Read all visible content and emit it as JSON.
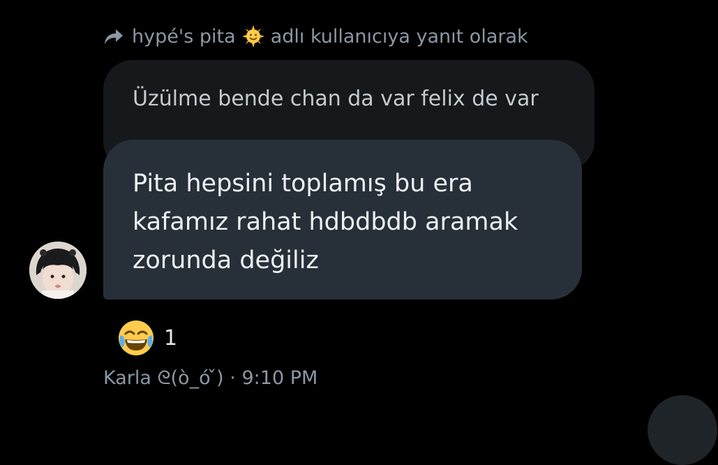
{
  "reply_header": {
    "icon": "reply-arrow-icon",
    "username": "hypé's pita",
    "emoji": "sun-with-face-icon",
    "suffix": "adlı kullanıcıya yanıt olarak"
  },
  "quoted_message": {
    "text": "Üzülme bende chan da var felix de var"
  },
  "message": {
    "text": "Pita hepsini toplamış bu era kafamız rahat hdbdbdb aramak zorunda değiliz"
  },
  "reaction": {
    "emoji": "face-with-tears-of-joy-icon",
    "count": "1"
  },
  "meta": {
    "sender": "Karla ᘓ(ò_ó ̌)",
    "separator": "·",
    "time": "9:10 PM"
  },
  "colors": {
    "background": "#000000",
    "bubble": "#273038",
    "quoted_bubble": "#16181c",
    "muted_text": "#8b98a5"
  }
}
